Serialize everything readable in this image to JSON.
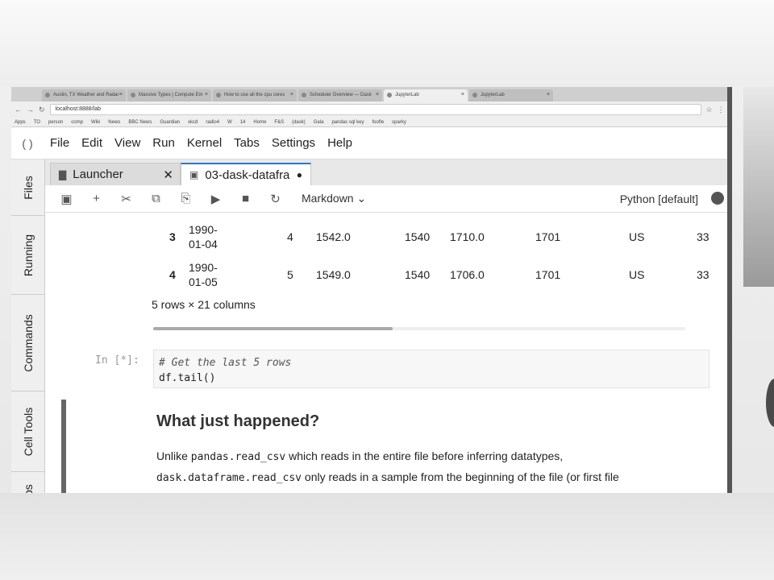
{
  "browser": {
    "tabs": [
      {
        "label": "Austin, TX Weather and Radar"
      },
      {
        "label": "Massive Types | Compute Em"
      },
      {
        "label": "How to use all the cpu cores"
      },
      {
        "label": "Scheduler Overview — Dask"
      },
      {
        "label": "JupyterLab"
      },
      {
        "label": "JupyterLab"
      }
    ],
    "url": "localhost:8888/lab",
    "bookmarks": [
      "Apps",
      "TO",
      "person",
      "comp",
      "Wiki",
      "News",
      "BBC News",
      "Guardian",
      "xkcd",
      "radio4",
      "W",
      "14",
      "Home",
      "F&S",
      "(dask)",
      "Gala",
      "pandas sql key",
      "foofle",
      "sparky"
    ]
  },
  "menu": {
    "items": [
      "File",
      "Edit",
      "View",
      "Run",
      "Kernel",
      "Tabs",
      "Settings",
      "Help"
    ]
  },
  "sidebar": {
    "tabs": [
      "Files",
      "Running",
      "Commands",
      "Cell Tools",
      "Tabs"
    ]
  },
  "doc_tabs": [
    {
      "label": "Launcher",
      "close": "✕"
    },
    {
      "label": "03-dask-datafra",
      "close": "●"
    }
  ],
  "toolbar": {
    "cell_type": "Markdown",
    "kernel": "Python [default]"
  },
  "table": {
    "rows": [
      {
        "index": "3",
        "date1": "1990-",
        "date2": "01-04",
        "v1": "4",
        "v2": "1542.0",
        "v3": "1540",
        "v4": "1710.0",
        "v5": "1701",
        "v6": "US",
        "v7": "33"
      },
      {
        "index": "4",
        "date1": "1990-",
        "date2": "01-05",
        "v1": "5",
        "v2": "1549.0",
        "v3": "1540",
        "v4": "1706.0",
        "v5": "1701",
        "v6": "US",
        "v7": "33"
      }
    ],
    "shape": "5 rows × 21 columns",
    "scroll_fraction": 0.45
  },
  "code_cell": {
    "prompt": "In [*]:",
    "comment": "# Get the last 5 rows",
    "code": "df.tail()"
  },
  "markdown": {
    "heading": "What just happened?",
    "p1_pre": "Unlike ",
    "p1_code": "pandas.read_csv",
    "p1_post": " which reads in the entire file before inferring datatypes,",
    "p2_code": "dask.dataframe.read_csv",
    "p2_post": " only reads in a sample from the beginning of the file (or first file"
  }
}
